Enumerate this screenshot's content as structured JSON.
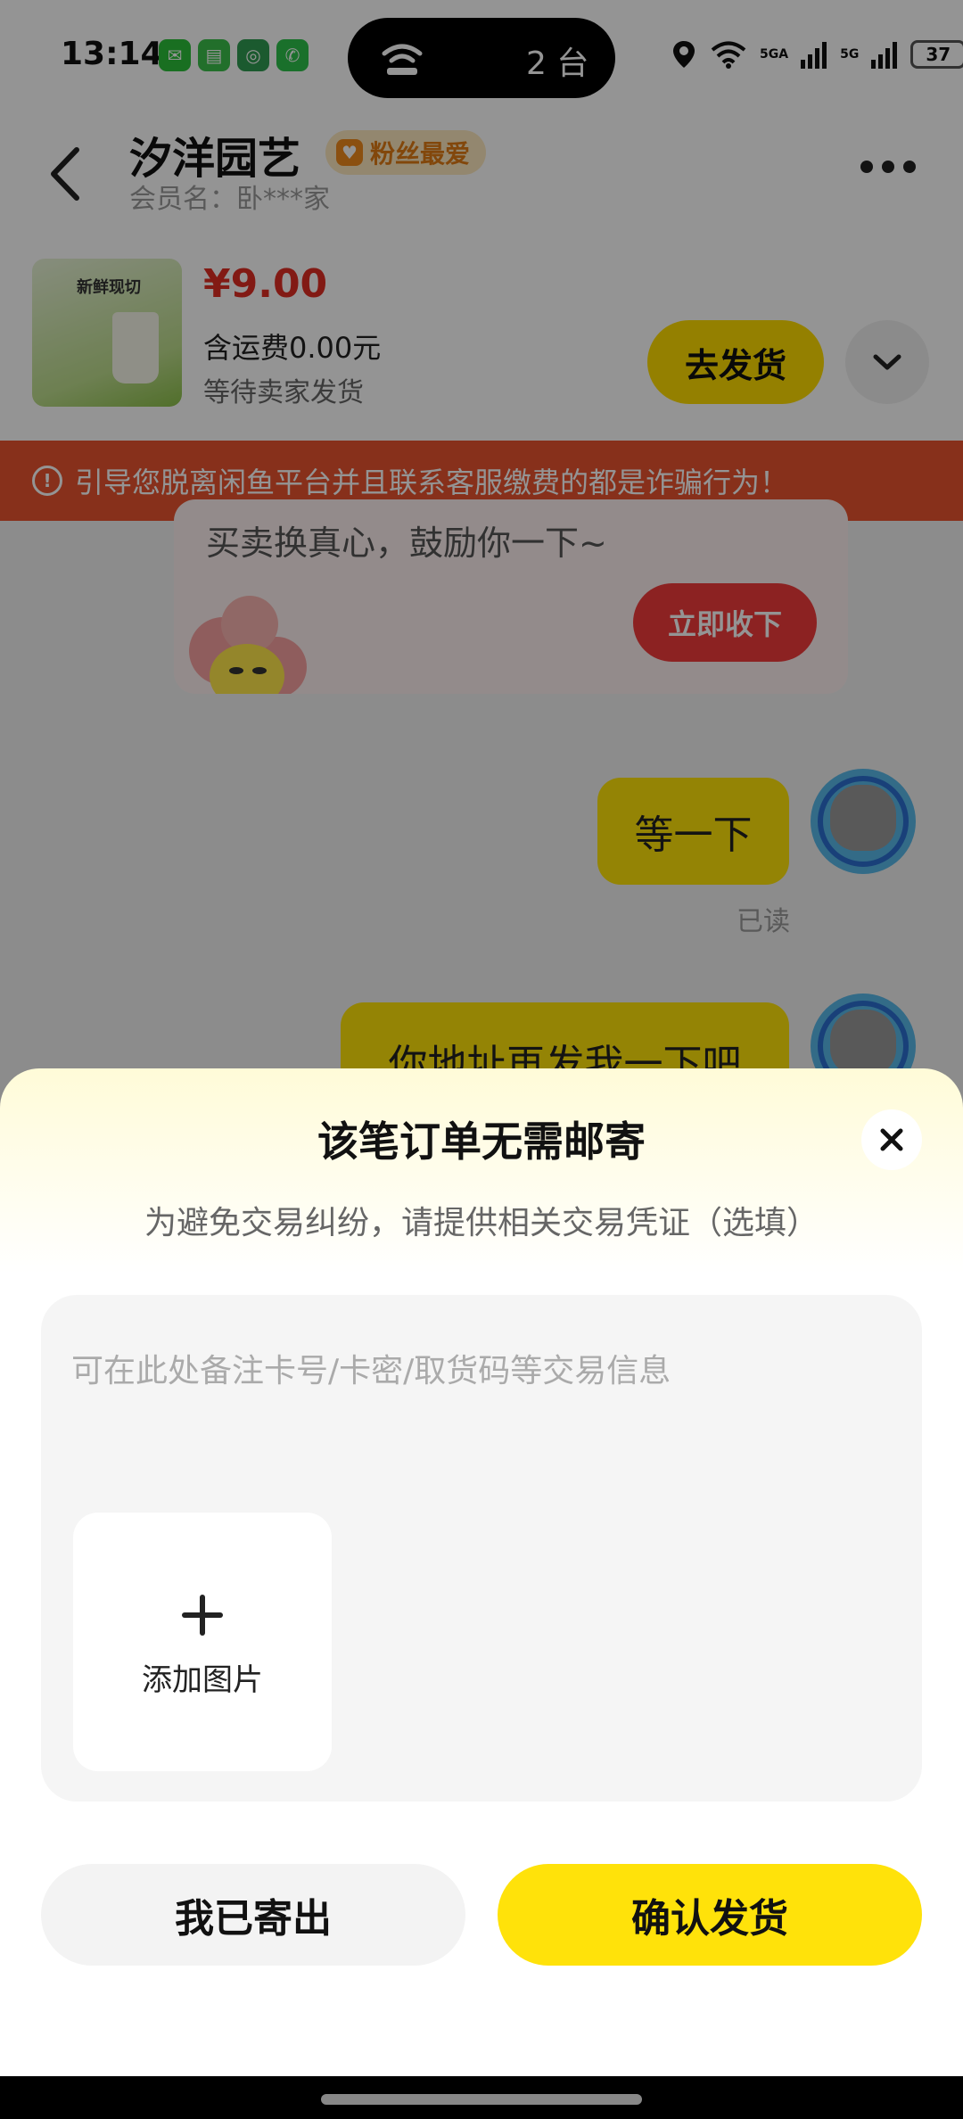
{
  "status_bar": {
    "time": "13:14",
    "island_count": "2 台",
    "signal_1": "5GA",
    "signal_2": "5G",
    "battery": "37"
  },
  "header": {
    "shop_name": "汐洋园艺",
    "badge": "粉丝最爱",
    "member_name": "会员名：卧***家"
  },
  "order": {
    "thumb_text": "新鲜现切",
    "price": "¥9.00",
    "shipping": "含运费0.00元",
    "status": "等待卖家发货",
    "ship_button": "去发货"
  },
  "warning": {
    "text": "引导您脱离闲鱼平台并且联系客服缴费的都是诈骗行为！"
  },
  "chat": {
    "card_text": "买卖换真心，鼓励你一下~",
    "accept_button": "立即收下",
    "message_1": "等一下",
    "read_status": "已读",
    "message_2": "你地址再发我一下吧"
  },
  "sheet": {
    "title": "该笔订单无需邮寄",
    "subtitle": "为避免交易纠纷，请提供相关交易凭证（选填）",
    "note_value": "",
    "note_placeholder": "可在此处备注卡号/卡密/取货码等交易信息",
    "add_image": "添加图片",
    "sent_button": "我已寄出",
    "confirm_button": "确认发货"
  },
  "colors": {
    "accent_yellow": "#ffe20a",
    "warning_red": "#e8542f",
    "price_red": "#e02e24"
  }
}
